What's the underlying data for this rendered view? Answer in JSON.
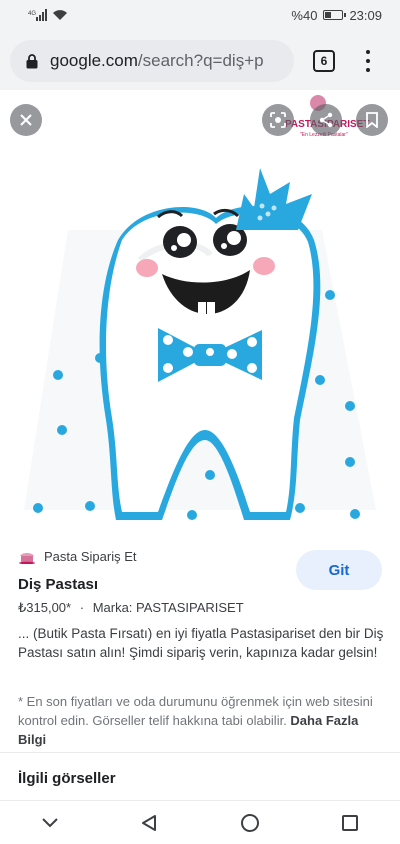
{
  "status_bar": {
    "battery_text": "%40",
    "time": "23:09",
    "battery_level": 0.4
  },
  "browser": {
    "url_main": "google.com",
    "url_rest": "/search?q=diş+p",
    "tab_count": "6"
  },
  "image_overlay": {
    "watermark_brand": "PASTASIPARISET",
    "watermark_tagline": "\"En Lezzetli Pastalar\""
  },
  "result": {
    "source": "Pasta Sipariş Et",
    "title": "Diş Pastası",
    "price": "₺315,00*",
    "separator": "·",
    "brand": "Marka: PASTASIPARISET",
    "visit_button": "Git",
    "description": "... (Butik Pasta Fırsatı) en iyi fiyatla Pastasipariset den bir Diş Pastası satın alın! Şimdi sipariş verin, kapınıza kadar gelsin!",
    "note": "* En son fiyatları ve oda durumunu öğrenmek için web sitesini kontrol edin. Görseller telif hakkına tabi olabilir.",
    "more_info": "Daha Fazla Bilgi",
    "related_heading": "İlgili görseller"
  },
  "colors": {
    "accent": "#1a73e8",
    "cake_blue": "#29a8df",
    "chip_bg": "#e8f0fe"
  }
}
